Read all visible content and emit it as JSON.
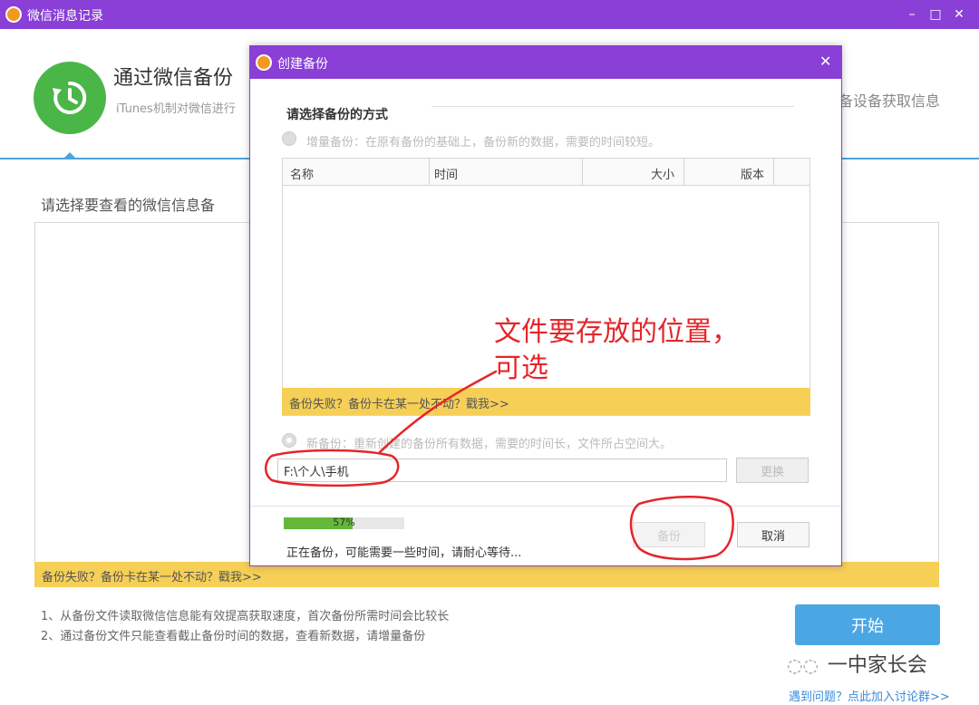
{
  "app": {
    "title": "微信消息记录",
    "window_controls": {
      "minimize": "–",
      "maximize": "□",
      "close": "✕"
    }
  },
  "header": {
    "icon": "history-clock-icon",
    "title": "通过微信备份",
    "subtitle": "iTunes机制对微信进行",
    "right_text": "备设备获取信息"
  },
  "main": {
    "choose_label": "请选择要查看的微信信息备",
    "warning": "备份失败？备份卡在某一处不动？戳我>>",
    "notes": [
      "1、从备份文件读取微信信息能有效提高获取速度，首次备份所需时间会比较长",
      "2、通过备份文件只能查看截止备份时间的数据，查看新数据，请增量备份"
    ],
    "start_button": "开始",
    "watermark": "一中家长会",
    "help_link": "遇到问题？点此加入讨论群>>"
  },
  "dialog": {
    "title": "创建备份",
    "close": "✕",
    "heading": "请选择备份的方式",
    "incremental_option": "增量备份：在原有备份的基础上，备份新的数据，需要的时间较短。",
    "table": {
      "columns": [
        "名称",
        "时间",
        "大小",
        "版本"
      ]
    },
    "warning": "备份失败？备份卡在某一处不动？戳我>>",
    "new_option": "新备份：重新创建的备份所有数据，需要的时间长，文件所占空间大。",
    "path_value": "F:\\个人\\手机",
    "change_button": "更换",
    "progress": {
      "percent": 57,
      "label": "57%"
    },
    "status": "正在备份，可能需要一些时间，请耐心等待...",
    "backup_button": "备份",
    "cancel_button": "取消"
  },
  "annotation": {
    "line1": "文件要存放的位置，",
    "line2": "可选",
    "color": "#e4262a"
  },
  "colors": {
    "titlebar": "#8a3fd6",
    "accent_blue": "#4aa7e4",
    "warning_bg": "#f5cf56",
    "progress_green": "#63b83a",
    "icon_green": "#4bb648"
  }
}
